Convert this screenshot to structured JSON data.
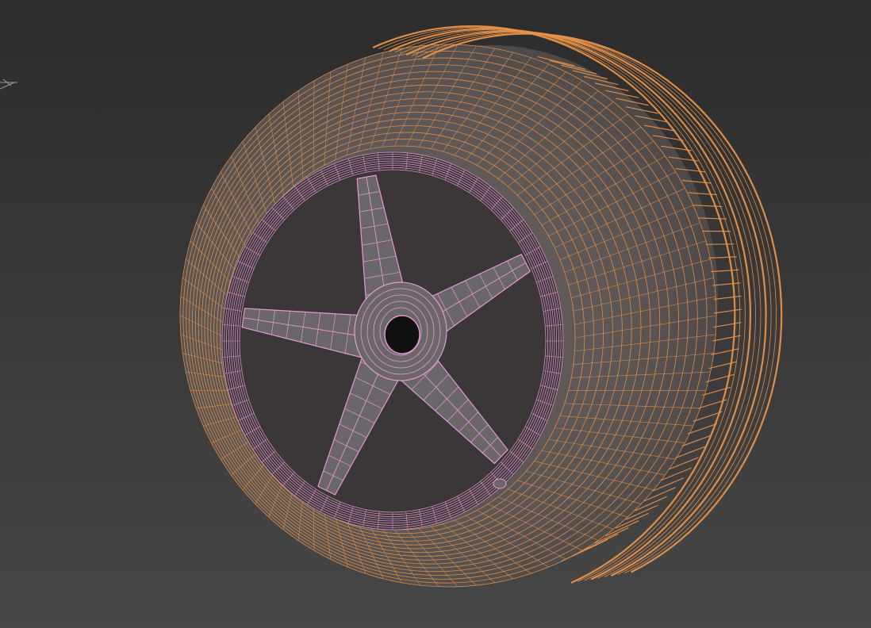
{
  "viewport": {
    "background_top": "#2c2c2c",
    "background_bottom": "#474747",
    "gizmo_color": "#9a9a9a"
  },
  "model": {
    "object_name_hint": "wheel",
    "tire_wire_color": "#e8924a",
    "rim_wire_color": "#e39ad2",
    "tire_shade_color": "#5a5552",
    "rim_shade_color": "#6b666a",
    "spoke_count": 5
  }
}
